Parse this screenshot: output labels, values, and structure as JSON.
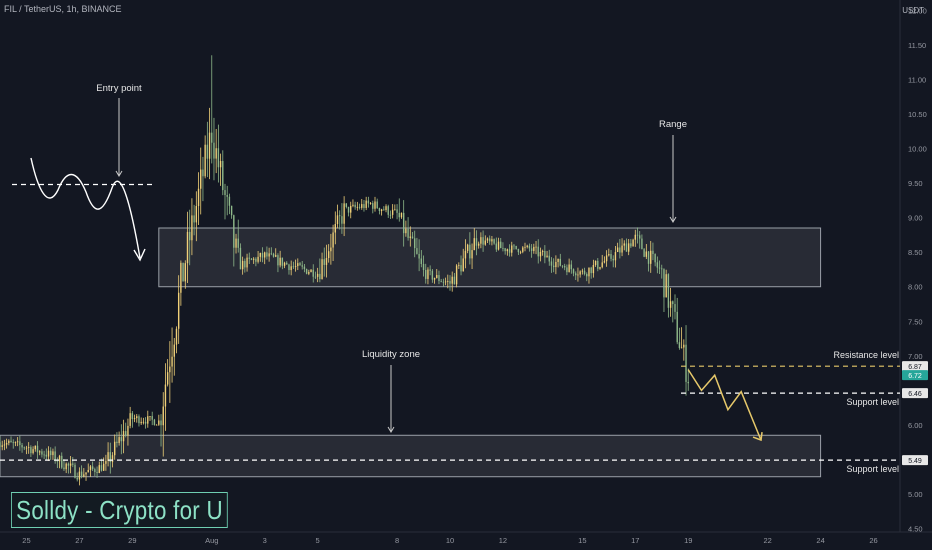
{
  "header": {
    "symbol": "FIL / TetherUS, 1h, BINANCE",
    "axis_unit": "USDT"
  },
  "watermark": {
    "text": "Solldy - Crypto for U"
  },
  "colors": {
    "bg": "#131722",
    "candle_up": "#f0d078",
    "candle_down": "#8fb98a",
    "zone_fill": "#3a3d45",
    "zone_stroke": "#9aa0a8",
    "text": "#e6e6e6",
    "axis_text": "#9598a1",
    "projection": "#e6c86a",
    "resistance_line": "#e6c86a"
  },
  "chart_data": {
    "type": "candlestick",
    "y_axis": {
      "ylim": [
        4.45,
        12.15
      ],
      "ticks": [
        4.5,
        5.0,
        5.5,
        6.0,
        6.5,
        7.0,
        7.5,
        8.0,
        8.5,
        9.0,
        9.5,
        10.0,
        10.5,
        11.0,
        11.5,
        12.0
      ],
      "tick_labels": [
        "4.50",
        "5.00",
        "5.50",
        "6.00",
        "6.50",
        "7.00",
        "7.50",
        "8.00",
        "8.50",
        "9.00",
        "9.50",
        "10.00",
        "10.50",
        "11.00",
        "11.50",
        "12.00"
      ]
    },
    "x_axis": {
      "start": "2021-07-24",
      "end": "2021-08-27",
      "ticks": [
        {
          "label": "25",
          "date": "2021-07-25"
        },
        {
          "label": "27",
          "date": "2021-07-27"
        },
        {
          "label": "29",
          "date": "2021-07-29"
        },
        {
          "label": "Aug",
          "date": "2021-08-01"
        },
        {
          "label": "3",
          "date": "2021-08-03"
        },
        {
          "label": "5",
          "date": "2021-08-05"
        },
        {
          "label": "8",
          "date": "2021-08-08"
        },
        {
          "label": "10",
          "date": "2021-08-10"
        },
        {
          "label": "12",
          "date": "2021-08-12"
        },
        {
          "label": "15",
          "date": "2021-08-15"
        },
        {
          "label": "17",
          "date": "2021-08-17"
        },
        {
          "label": "19",
          "date": "2021-08-19"
        },
        {
          "label": "22",
          "date": "2021-08-22"
        },
        {
          "label": "24",
          "date": "2021-08-24"
        },
        {
          "label": "26",
          "date": "2021-08-26"
        }
      ]
    },
    "price_path": [
      {
        "date": "2021-07-24",
        "close": 5.75
      },
      {
        "date": "2021-07-25",
        "close": 5.68
      },
      {
        "date": "2021-07-26",
        "close": 5.55
      },
      {
        "date": "2021-07-27",
        "close": 5.28
      },
      {
        "date": "2021-07-28",
        "close": 5.42
      },
      {
        "date": "2021-07-29",
        "close": 6.1
      },
      {
        "date": "2021-07-30",
        "close": 6.05
      },
      {
        "date": "2021-07-31",
        "close": 8.4
      },
      {
        "date": "2021-08-01",
        "close": 10.25
      },
      {
        "date": "2021-08-02",
        "close": 8.3
      },
      {
        "date": "2021-08-03",
        "close": 8.45
      },
      {
        "date": "2021-08-04",
        "close": 8.3
      },
      {
        "date": "2021-08-05",
        "close": 8.2
      },
      {
        "date": "2021-08-06",
        "close": 9.1
      },
      {
        "date": "2021-08-07",
        "close": 9.2
      },
      {
        "date": "2021-08-08",
        "close": 9.05
      },
      {
        "date": "2021-08-09",
        "close": 8.2
      },
      {
        "date": "2021-08-10",
        "close": 8.05
      },
      {
        "date": "2021-08-11",
        "close": 8.7
      },
      {
        "date": "2021-08-12",
        "close": 8.55
      },
      {
        "date": "2021-08-13",
        "close": 8.55
      },
      {
        "date": "2021-08-14",
        "close": 8.35
      },
      {
        "date": "2021-08-15",
        "close": 8.2
      },
      {
        "date": "2021-08-16",
        "close": 8.4
      },
      {
        "date": "2021-08-17",
        "close": 8.7
      },
      {
        "date": "2021-08-18",
        "close": 8.2
      },
      {
        "date": "2021-08-19",
        "close": 6.72
      }
    ],
    "spike_high": {
      "date": "2021-08-01",
      "value": 11.35
    },
    "annotations": [
      {
        "label": "Entry point"
      },
      {
        "label": "Range"
      },
      {
        "label": "Liquidity zone"
      }
    ],
    "zones": [
      {
        "name": "Range",
        "y": [
          8.0,
          8.85
        ],
        "x": [
          "2021-07-30",
          "2021-08-24"
        ]
      },
      {
        "name": "Liquidity zone",
        "y": [
          5.25,
          5.85
        ],
        "x": [
          "2021-07-23",
          "2021-08-24"
        ]
      }
    ],
    "levels": [
      {
        "label": "Resistance level",
        "value": 6.85,
        "tag": "6.87",
        "style": "dashed",
        "color": "#e6c86a"
      },
      {
        "label": "Support level",
        "value": 6.46,
        "tag": "6.46",
        "style": "dashed",
        "color": "#ffffff"
      },
      {
        "label": "Support level",
        "value": 5.49,
        "tag": "5.49",
        "style": "dashed",
        "color": "#ffffff"
      }
    ],
    "last_price": {
      "value": 6.72,
      "label": "6.72",
      "color": "#26a69a"
    },
    "entry_line": {
      "value": 9.48
    },
    "projection_path": [
      {
        "date": "2021-08-19",
        "value": 6.8
      },
      {
        "date": "2021-08-19T12",
        "value": 6.5
      },
      {
        "date": "2021-08-20",
        "value": 6.72
      },
      {
        "date": "2021-08-20T12",
        "value": 6.22
      },
      {
        "date": "2021-08-21",
        "value": 6.48
      },
      {
        "date": "2021-08-21T18",
        "value": 5.78
      }
    ]
  }
}
